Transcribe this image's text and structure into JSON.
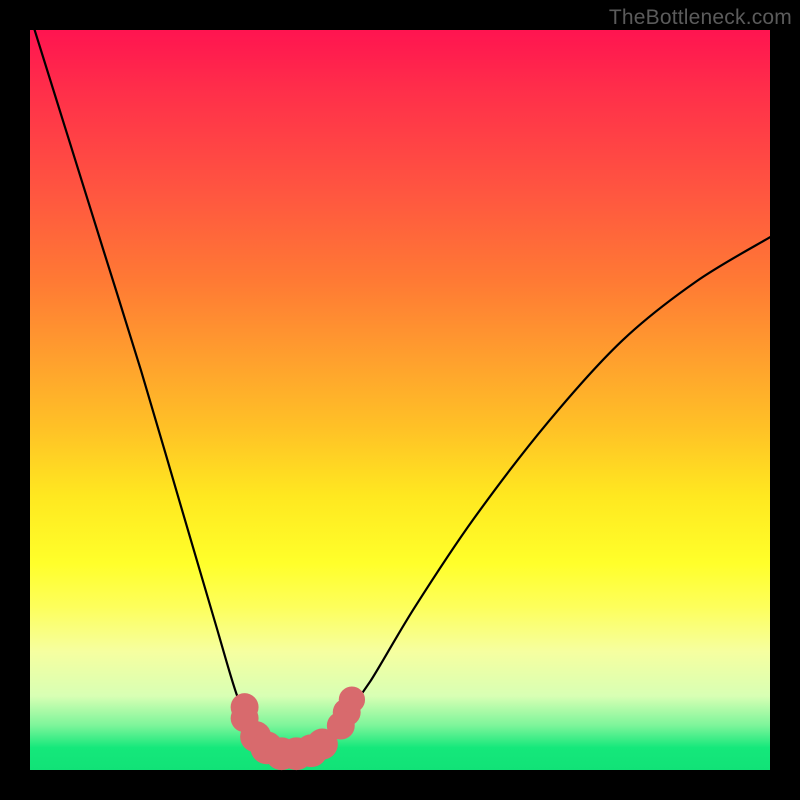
{
  "watermark": "TheBottleneck.com",
  "chart_data": {
    "type": "line",
    "title": "",
    "xlabel": "",
    "ylabel": "",
    "xlim": [
      0,
      100
    ],
    "ylim": [
      0,
      100
    ],
    "series": [
      {
        "name": "curve",
        "x": [
          0,
          5,
          10,
          15,
          20,
          25,
          28,
          30,
          32,
          33.5,
          35,
          37,
          39,
          41,
          43,
          46,
          52,
          60,
          70,
          80,
          90,
          100
        ],
        "y": [
          102,
          86,
          70,
          54,
          37,
          20,
          10,
          6,
          3,
          2.2,
          2,
          2.2,
          3,
          5,
          8,
          12,
          22,
          34,
          47,
          58,
          66,
          72
        ]
      }
    ],
    "markers": {
      "name": "highlight-dots",
      "color": "#d86a6d",
      "points": [
        {
          "x": 29.0,
          "y": 8.5,
          "r": 2.2
        },
        {
          "x": 29.0,
          "y": 7.0,
          "r": 2.2
        },
        {
          "x": 30.5,
          "y": 4.5,
          "r": 2.6
        },
        {
          "x": 32.0,
          "y": 3.0,
          "r": 2.8
        },
        {
          "x": 34.0,
          "y": 2.2,
          "r": 2.8
        },
        {
          "x": 36.0,
          "y": 2.2,
          "r": 2.8
        },
        {
          "x": 38.0,
          "y": 2.6,
          "r": 2.8
        },
        {
          "x": 39.5,
          "y": 3.5,
          "r": 2.6
        },
        {
          "x": 42.0,
          "y": 6.0,
          "r": 2.2
        },
        {
          "x": 42.8,
          "y": 7.8,
          "r": 2.2
        },
        {
          "x": 43.5,
          "y": 9.5,
          "r": 2.0
        }
      ]
    }
  }
}
